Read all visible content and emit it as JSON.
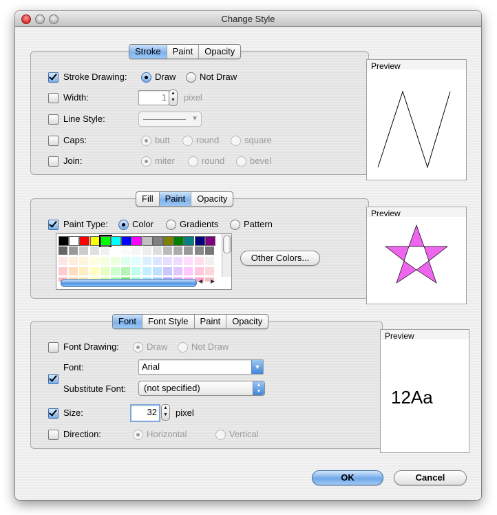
{
  "window": {
    "title": "Change Style"
  },
  "stroke_section": {
    "tabs": [
      "Stroke",
      "Paint",
      "Opacity"
    ],
    "selected_tab": "Stroke",
    "stroke_drawing": {
      "label": "Stroke Drawing:",
      "checked": true,
      "options": [
        "Draw",
        "Not Draw"
      ],
      "selected": "Draw"
    },
    "width": {
      "label": "Width:",
      "value": "1",
      "unit": "pixel",
      "checked": false
    },
    "line_style": {
      "label": "Line Style:",
      "checked": false
    },
    "caps": {
      "label": "Caps:",
      "checked": false,
      "options": [
        "butt",
        "round",
        "square"
      ],
      "selected": "butt"
    },
    "join": {
      "label": "Join:",
      "checked": false,
      "options": [
        "miter",
        "round",
        "bevel"
      ],
      "selected": "miter"
    },
    "preview_label": "Preview"
  },
  "fill_section": {
    "tabs": [
      "Fill",
      "Paint",
      "Opacity"
    ],
    "selected_tab": "Paint",
    "paint_type": {
      "label": "Paint Type:",
      "checked": true,
      "options": [
        "Color",
        "Gradients",
        "Pattern"
      ],
      "selected": "Color"
    },
    "other_colors_label": "Other Colors...",
    "palette_colors": [
      [
        "#000000",
        "#ffffff",
        "#ff0000",
        "#ffff00",
        "#00ff00",
        "#00ffff",
        "#0000ff",
        "#ff00ff",
        "#c0c0c0",
        "#808080",
        "#808000",
        "#008000",
        "#008080",
        "#000080",
        "#800080"
      ],
      [
        "#666666",
        "#999999",
        "#cccccc",
        "#e0e0e0",
        "#f0f0f0",
        "#ffffff",
        "#fafafa",
        "#f5f5f5",
        "#eeeeee",
        "#dddddd",
        "#bbbbbb",
        "#aaaaaa",
        "#999999",
        "#888888",
        "#777777"
      ],
      [
        "#ffe6e6",
        "#ffeedd",
        "#fff5dd",
        "#ffffdd",
        "#f5ffdd",
        "#eeffdd",
        "#ddffee",
        "#ddffff",
        "#ddeeff",
        "#dde6ff",
        "#e6ddff",
        "#eeddff",
        "#ffddff",
        "#ffddee",
        "#f0f0f0"
      ],
      [
        "#ffcccc",
        "#ffdec0",
        "#ffeec0",
        "#ffffc0",
        "#e6ffc0",
        "#ccffcc",
        "#b3f5b3",
        "#c0ffee",
        "#c0f0ff",
        "#c0e0ff",
        "#c8c8ff",
        "#e0c8ff",
        "#ffc8ff",
        "#ffc8e0",
        "#f8d8d8"
      ],
      [
        "#ffb3b3",
        "#ffd1a3",
        "#ffe6a3",
        "#ffffa3",
        "#ccff99",
        "#99ff99",
        "#66e666",
        "#99ffcc",
        "#99e6ff",
        "#99ccff",
        "#a3a3ff",
        "#cca3ff",
        "#ffa3ff",
        "#ffa3cc",
        "#f0c0c0"
      ]
    ],
    "selected_color": "#00ff00",
    "preview_label": "Preview",
    "star_color": "#ee66ee"
  },
  "font_section": {
    "tabs": [
      "Font",
      "Font Style",
      "Paint",
      "Opacity"
    ],
    "selected_tab": "Font",
    "font_drawing": {
      "label": "Font Drawing:",
      "checked": false,
      "options": [
        "Draw",
        "Not Draw"
      ],
      "selected": "Draw"
    },
    "font": {
      "label": "Font:",
      "value": "Arial",
      "checked": true
    },
    "substitute_font": {
      "label": "Substitute Font:",
      "value": "(not specified)"
    },
    "size": {
      "label": "Size:",
      "value": "32",
      "unit": "pixel",
      "checked": true
    },
    "direction": {
      "label": "Direction:",
      "checked": false,
      "options": [
        "Horizontal",
        "Vertical"
      ],
      "selected": "Horizontal"
    },
    "preview_label": "Preview",
    "preview_text": "12Aa"
  },
  "buttons": {
    "ok": "OK",
    "cancel": "Cancel"
  },
  "colors": {
    "accent": "#6fa7e7"
  }
}
